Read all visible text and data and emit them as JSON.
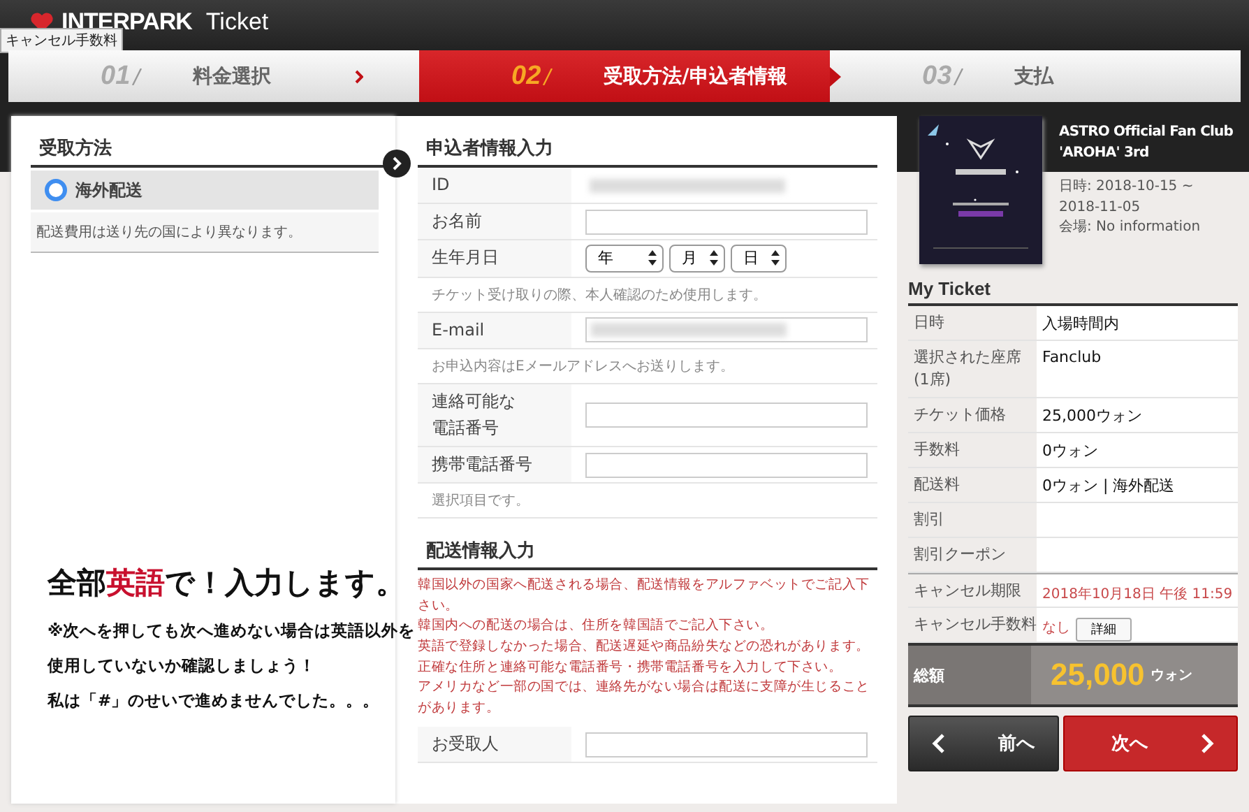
{
  "header": {
    "logo": "INTERPARK",
    "product": "Ticket"
  },
  "tooltip": "キャンセル手数料",
  "steps": [
    {
      "number": "01",
      "label": "料金選択",
      "selected": false
    },
    {
      "number": "02",
      "label": "受取方法/申込者情報",
      "selected": true
    },
    {
      "number": "03",
      "label": "支払",
      "selected": false
    }
  ],
  "delivery": {
    "title": "受取方法",
    "options": [
      {
        "label": "海外配送",
        "selected": true
      }
    ],
    "note": "配送費用は送り先の国により異なります。"
  },
  "applicant": {
    "title": "申込者情報入力",
    "rows": [
      {
        "kind": "masked",
        "label": "ID"
      },
      {
        "kind": "input",
        "label": "お名前"
      },
      {
        "kind": "date",
        "label": "生年月日",
        "selects": [
          "年",
          "月",
          "日"
        ]
      },
      {
        "kind": "note",
        "text": "チケット受け取りの際、本人確認のため使用します。"
      },
      {
        "kind": "masked-input",
        "label": "E-mail"
      },
      {
        "kind": "note",
        "text": "お申込内容はEメールアドレスへお送りします。"
      },
      {
        "kind": "input",
        "label": [
          "連絡可能な",
          "電話番号"
        ]
      },
      {
        "kind": "input",
        "label": "携帯電話番号"
      },
      {
        "kind": "note",
        "text": "選択項目です。"
      }
    ]
  },
  "shipping": {
    "title": "配送情報入力",
    "notes": [
      "韓国以外の国家へ配送される場合、配送情報をアルファベットでご記入下さい。",
      "韓国内への配送の場合は、住所を韓国語でご記入下さい。",
      "英語で登録しなかった場合、配送遅延や商品紛失などの恐れがあります。",
      "正確な住所と連絡可能な電話番号・携帯電話番号を入力して下さい。",
      "アメリカなど一部の国では、連絡先がない場合は配送に支障が生じることがあります。"
    ],
    "rows": [
      {
        "kind": "input",
        "label": "お受取人"
      }
    ]
  },
  "event": {
    "title": "ASTRO Official Fan Club 'AROHA' 3rd",
    "date": "日時: 2018-10-15 ~ 2018-11-05",
    "venue": "会場: No information"
  },
  "my_ticket": {
    "title": "My Ticket",
    "rows": [
      {
        "label": "日時",
        "value": "入場時間内"
      },
      {
        "label": "選択された座席(1席)",
        "value": "Fanclub"
      },
      {
        "label": "チケット価格",
        "value": "25,000ウォン"
      },
      {
        "label": "手数料",
        "value": "0ウォン"
      },
      {
        "label": "配送料",
        "value": "0ウォン | 海外配送"
      },
      {
        "label": "割引"
      },
      {
        "label": "割引クーポン"
      },
      {
        "label": "キャンセル期限",
        "value": "2018年10月18日 午後 11:59",
        "kind": "alert"
      },
      {
        "label": "キャンセル手数料",
        "value": "なし",
        "kind": "alert",
        "button": "詳細"
      }
    ],
    "total_label": "総額",
    "total": "25,000",
    "currency": "ウォン"
  },
  "buttons": {
    "prev": "前へ",
    "next": "次へ"
  },
  "caption": {
    "headline": "全部**英語**で！入力します。",
    "lines": [
      "※次へを押しても次へ進めない場合は英語以外を",
      "使用していないか確認しましょう！",
      "私は「#」のせいで進めませんでした。。。"
    ]
  }
}
